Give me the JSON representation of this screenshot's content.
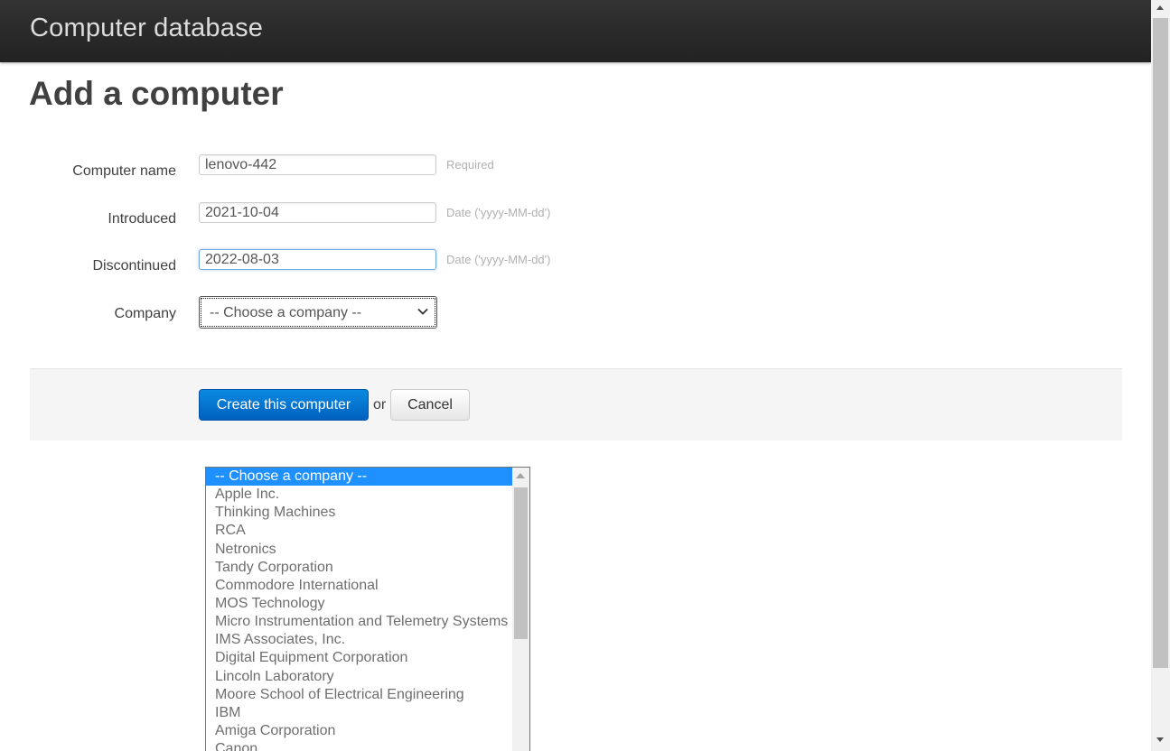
{
  "header": {
    "brand": "Computer database"
  },
  "main": {
    "title": "Add a computer",
    "fields": {
      "name": {
        "label": "Computer name",
        "value": "lenovo-442",
        "help": "Required"
      },
      "introduced": {
        "label": "Introduced",
        "value": "2021-10-04",
        "help": "Date ('yyyy-MM-dd')"
      },
      "discontinued": {
        "label": "Discontinued",
        "value": "2022-08-03",
        "help": "Date ('yyyy-MM-dd')"
      },
      "company": {
        "label": "Company",
        "selected": "-- Choose a company --"
      }
    },
    "actions": {
      "create_label": "Create this computer",
      "or_text": "or",
      "cancel_label": "Cancel"
    }
  },
  "company_options": [
    "-- Choose a company --",
    "Apple Inc.",
    "Thinking Machines",
    "RCA",
    "Netronics",
    "Tandy Corporation",
    "Commodore International",
    "MOS Technology",
    "Micro Instrumentation and Telemetry Systems",
    "IMS Associates, Inc.",
    "Digital Equipment Corporation",
    "Lincoln Laboratory",
    "Moore School of Electrical Engineering",
    "IBM",
    "Amiga Corporation",
    "Canon"
  ],
  "icons": {
    "select_arrow": "chevron-down-icon",
    "scroll_up": "scroll-up-arrow-icon",
    "scroll_down": "scroll-down-arrow-icon"
  },
  "colors": {
    "topbar": "#222222",
    "primary_button": "#0069d9",
    "selected_option": "#1e90ff"
  }
}
